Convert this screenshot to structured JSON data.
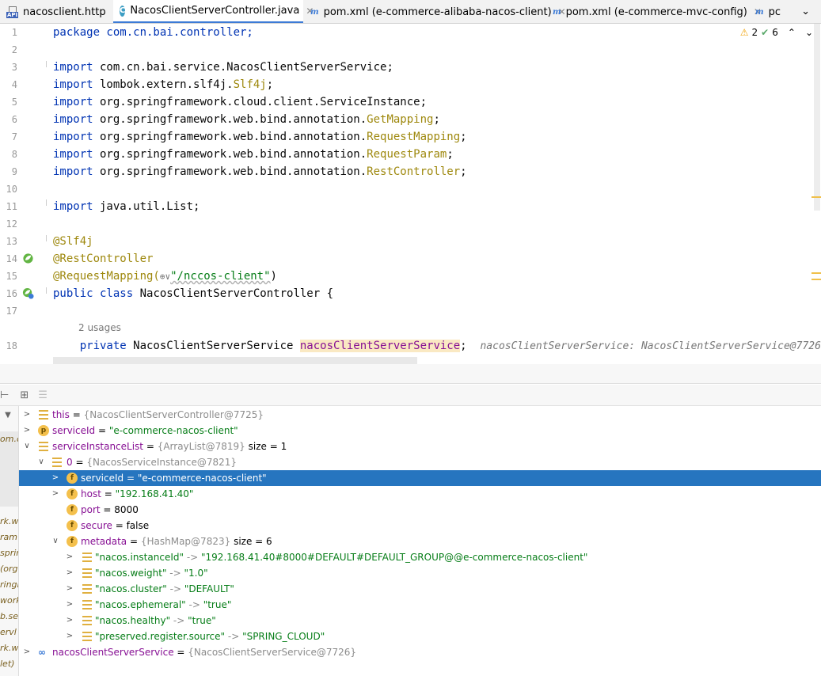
{
  "tabs": [
    {
      "label": "nacosclient.http",
      "icon": "api-file-icon"
    },
    {
      "label": "NacosClientServerController.java",
      "icon": "java-class-icon",
      "active": true
    },
    {
      "label": "pom.xml (e-commerce-alibaba-nacos-client)",
      "icon": "maven-icon"
    },
    {
      "label": "pom.xml (e-commerce-mvc-config)",
      "icon": "maven-icon"
    },
    {
      "label": "pc",
      "icon": "maven-icon"
    }
  ],
  "inspections": {
    "warnings": "2",
    "checks": "6"
  },
  "code": {
    "l1": "package com.cn.bai.controller;",
    "l3a": "import",
    "l3b": " com.cn.bai.service.NacosClientServerService;",
    "l4a": "import",
    "l4b": " lombok.extern.slf4j.",
    "l4c": "Slf4j",
    "l4d": ";",
    "l5a": "import",
    "l5b": " org.springframework.cloud.client.ServiceInstance;",
    "l6a": "import",
    "l6b": " org.springframework.web.bind.annotation.",
    "l6c": "GetMapping",
    "l6d": ";",
    "l7a": "import",
    "l7b": " org.springframework.web.bind.annotation.",
    "l7c": "RequestMapping",
    "l7d": ";",
    "l8a": "import",
    "l8b": " org.springframework.web.bind.annotation.",
    "l8c": "RequestParam",
    "l8d": ";",
    "l9a": "import",
    "l9b": " org.springframework.web.bind.annotation.",
    "l9c": "RestController",
    "l9d": ";",
    "l11a": "import",
    "l11b": " java.util.List;",
    "l13": "@Slf4j",
    "l14": "@RestController",
    "l15a": "@RequestMapping(",
    "l15b": "⊕∨",
    "l15c": "\"/nccos-client\"",
    "l15d": ")",
    "l16a": "public class",
    "l16b": " NacosClientServerController {",
    "usages": "2 usages",
    "l18a": "    private",
    "l18b": " NacosClientServerService ",
    "l18c": "nacosClientServerService",
    "l18d": ";",
    "l18inlay": "nacosClientServerService: NacosClientServerService@7726"
  },
  "line_numbers": [
    "1",
    "2",
    "3",
    "4",
    "5",
    "6",
    "7",
    "8",
    "9",
    "10",
    "11",
    "12",
    "13",
    "14",
    "15",
    "16",
    "17",
    "18"
  ],
  "frames": [
    "om.c",
    "",
    "rk.w",
    "ram",
    "sprin",
    "(org",
    "ringi",
    "work",
    "b.se",
    "ervl",
    "rk.w",
    "let)"
  ],
  "vars": {
    "this_name": "this",
    "this_val": "{NacosClientServerController@7725}",
    "sid_name": "serviceId",
    "sid_val": "\"e-commerce-nacos-client\"",
    "sil_name": "serviceInstanceList",
    "sil_val": "{ArrayList@7819}",
    "sil_size": "size = 1",
    "i0_name": "0",
    "i0_val": "{NacosServiceInstance@7821}",
    "f_sid_name": "serviceId",
    "f_sid_val": "\"e-commerce-nacos-client\"",
    "f_host_name": "host",
    "f_host_val": "\"192.168.41.40\"",
    "f_port_name": "port",
    "f_port_val": "8000",
    "f_secure_name": "secure",
    "f_secure_val": "false",
    "f_meta_name": "metadata",
    "f_meta_val": "{HashMap@7823}",
    "f_meta_size": "size = 6",
    "m1k": "\"nacos.instanceId\"",
    "m1v": "\"192.168.41.40#8000#DEFAULT#DEFAULT_GROUP@@e-commerce-nacos-client\"",
    "m2k": "\"nacos.weight\"",
    "m2v": "\"1.0\"",
    "m3k": "\"nacos.cluster\"",
    "m3v": "\"DEFAULT\"",
    "m4k": "\"nacos.ephemeral\"",
    "m4v": "\"true\"",
    "m5k": "\"nacos.healthy\"",
    "m5v": "\"true\"",
    "m6k": "\"preserved.register.source\"",
    "m6v": "\"SPRING_CLOUD\"",
    "ncs_name": "nacosClientServerService",
    "ncs_val": "{NacosClientServerService@7726}",
    "eq": " = ",
    "arrow": " -> "
  },
  "colors": {
    "accent": "#2675bf",
    "keyword": "#0033b3",
    "annotation": "#9e880d",
    "string": "#067d17"
  }
}
